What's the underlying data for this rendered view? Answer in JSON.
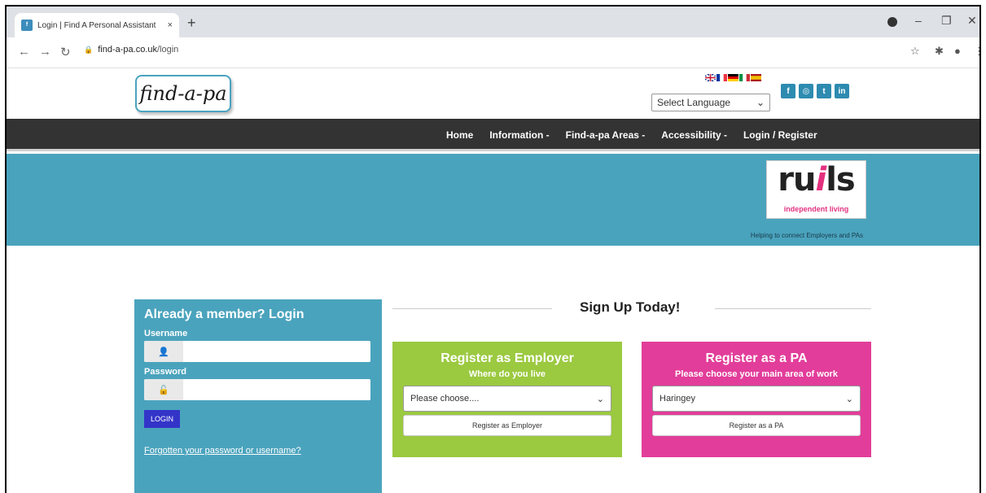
{
  "browser": {
    "tab_title": "Login | Find A Personal Assistant",
    "tab_close": "×",
    "new_tab": "+",
    "url_host": "find-a-pa.co.uk",
    "url_path": "/login"
  },
  "header": {
    "logo_text": "find-a-pa",
    "language_select": "Select Language",
    "social": {
      "facebook": "f",
      "instagram": "◎",
      "twitter": "t",
      "linkedin": "in"
    }
  },
  "nav": {
    "items": [
      "Home",
      "Information -",
      "Find-a-pa Areas -",
      "Accessibility -",
      "Login / Register"
    ]
  },
  "banner": {
    "ruils_word_left": "ru",
    "ruils_word_i": "i",
    "ruils_word_right": "ls",
    "ruils_tagline": "independent living",
    "tagline": "Helping to connect Employers and PAs"
  },
  "login": {
    "title": "Already a member? Login",
    "username_label": "Username",
    "password_label": "Password",
    "username_value": "",
    "password_value": "",
    "login_button": "LOGIN",
    "forgot_link": "Forgotten your password or username?"
  },
  "signup": {
    "title": "Sign Up Today!",
    "employer": {
      "title": "Register as Employer",
      "subtitle": "Where do you live",
      "select_value": "Please choose....",
      "button": "Register as Employer"
    },
    "pa": {
      "title": "Register as a PA",
      "subtitle": "Please choose your main area of work",
      "select_value": "Haringey",
      "button": "Register as a PA"
    }
  },
  "colors": {
    "teal": "#4aa3bd",
    "navbar": "#333333",
    "employer_green": "#9bc940",
    "pa_pink": "#e23d9a",
    "login_button": "#3334c8"
  }
}
